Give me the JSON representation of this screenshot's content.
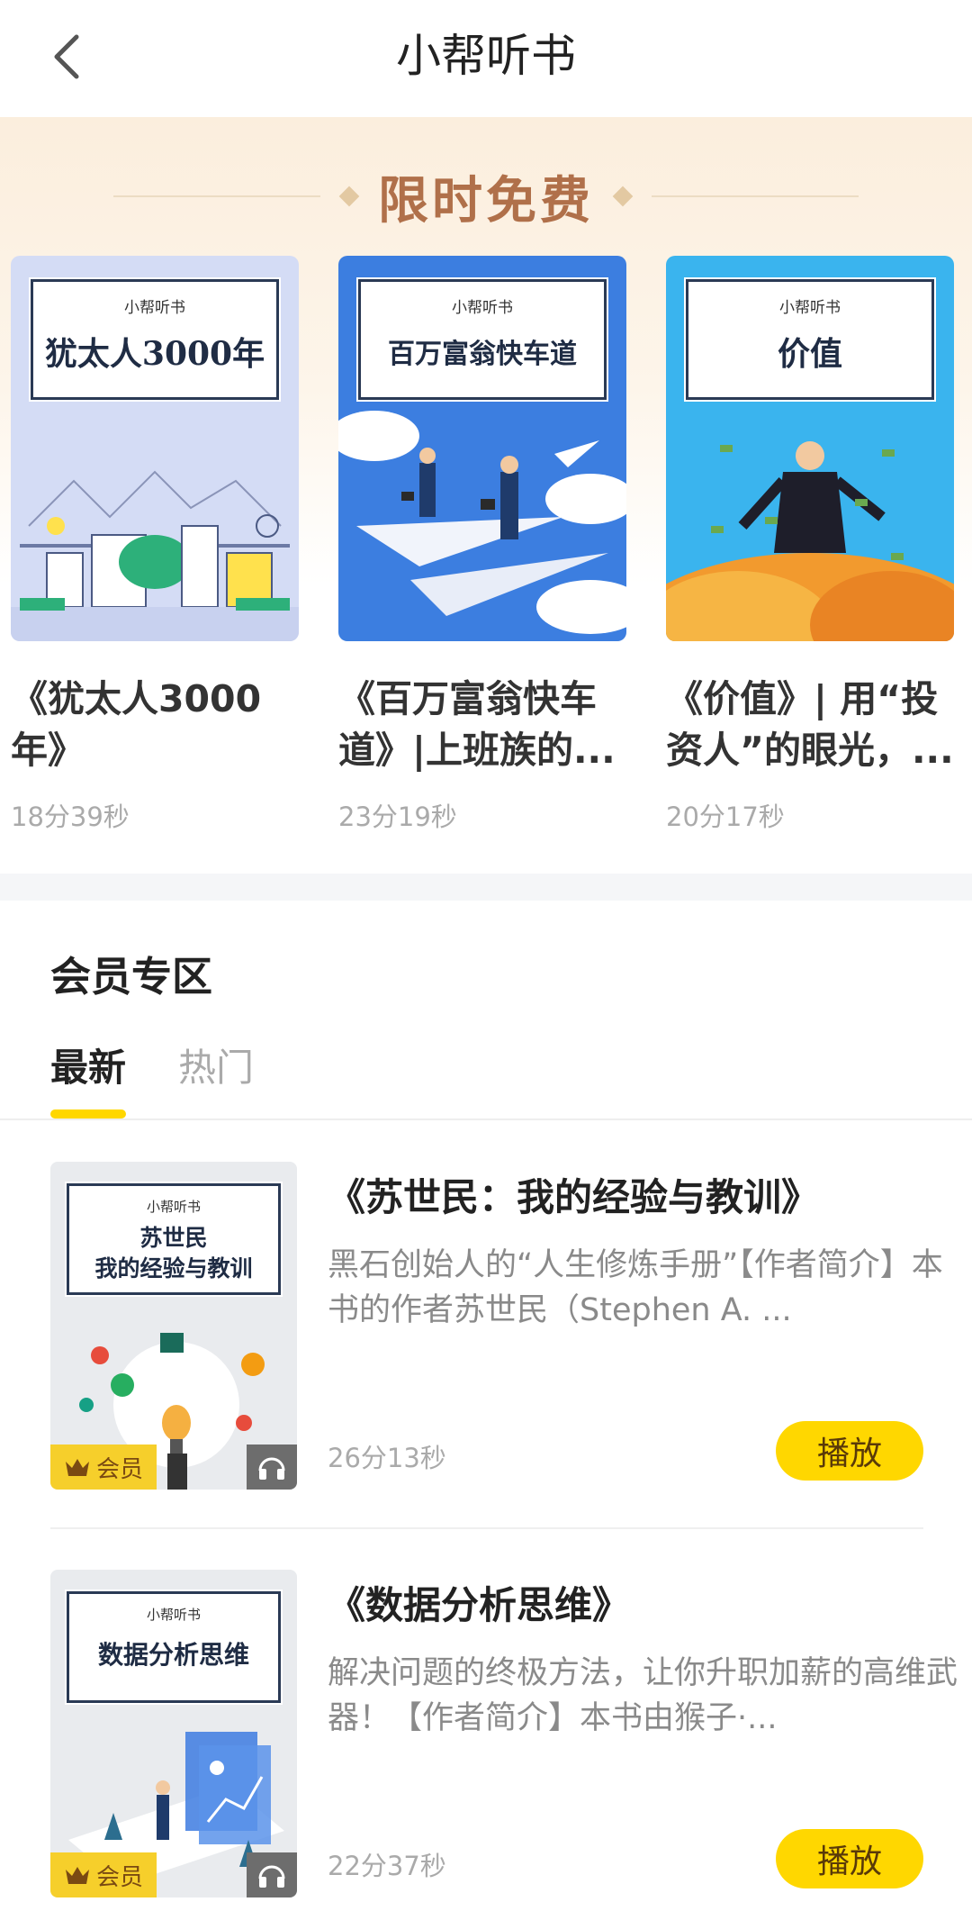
{
  "header": {
    "title": "小帮听书",
    "back_icon": "chevron-left-icon"
  },
  "free_section": {
    "title": "限时免费",
    "cards": [
      {
        "cover_brand": "小帮听书",
        "cover_title": "犹太人3000年",
        "title": "《犹太人3000年》",
        "duration": "18分39秒",
        "cover_color": "#d4dcf5"
      },
      {
        "cover_brand": "小帮听书",
        "cover_title": "百万富翁快车道",
        "title": "《百万富翁快车道》|上班族的...",
        "duration": "23分19秒",
        "cover_color": "#3c7ee0"
      },
      {
        "cover_brand": "小帮听书",
        "cover_title": "价值",
        "title": "《价值》| 用“投资人”的眼光，...",
        "duration": "20分17秒",
        "cover_color": "#3ab4ee"
      }
    ]
  },
  "member_section": {
    "title": "会员专区",
    "tabs": [
      {
        "label": "最新",
        "active": true
      },
      {
        "label": "热门",
        "active": false
      }
    ],
    "items": [
      {
        "cover_brand": "小帮听书",
        "cover_title": "苏世民\n我的经验与教训",
        "badge": "会员",
        "title": "《苏世民：我的经验与教训》",
        "description": "黑石创始人的“人生修炼手册”【作者简介】本书的作者苏世民（Stephen A. ...",
        "duration": "26分13秒",
        "play_label": "播放"
      },
      {
        "cover_brand": "小帮听书",
        "cover_title": "数据分析思维",
        "badge": "会员",
        "title": "《数据分析思维》",
        "description": "解决问题的终极方法，让你升职加薪的高维武器！【作者简介】本书由猴子·...",
        "duration": "22分37秒",
        "play_label": "播放"
      }
    ]
  },
  "colors": {
    "accent": "#ffd700",
    "free_title": "#b0704a",
    "vip_badge": "#f6cf2b"
  }
}
